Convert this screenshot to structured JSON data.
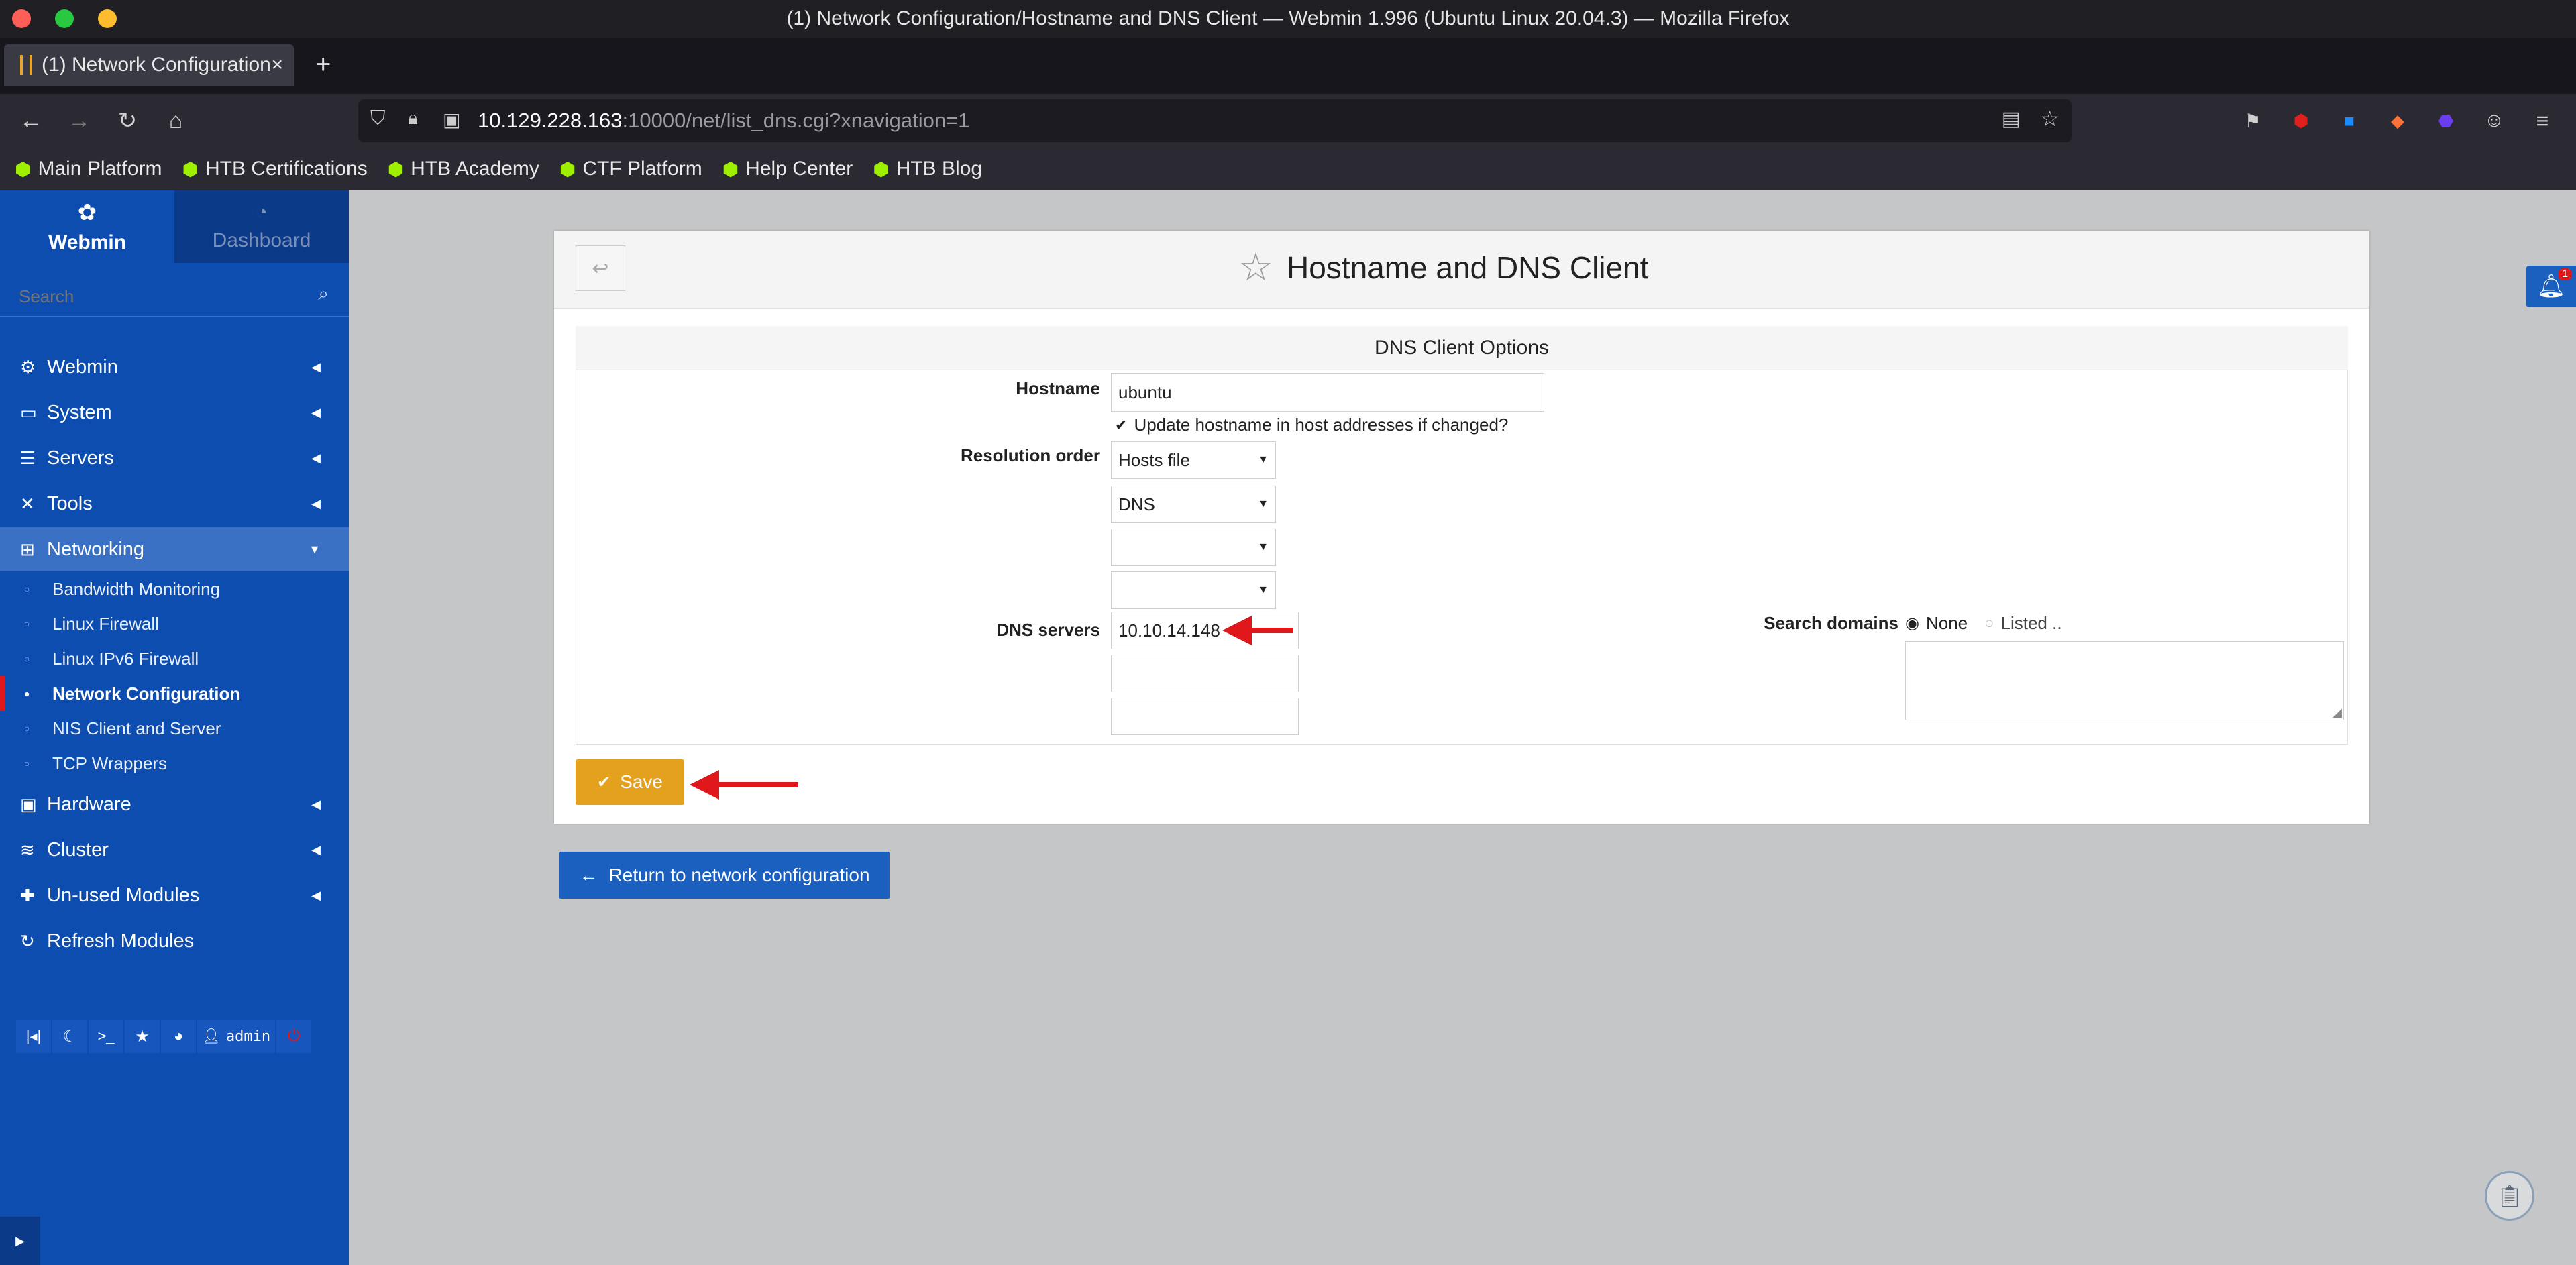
{
  "window": {
    "title": "(1) Network Configuration/Hostname and DNS Client — Webmin 1.996 (Ubuntu Linux 20.04.3) — Mozilla Firefox"
  },
  "browser": {
    "tab_title": "(1) Network Configuration",
    "url_host": "10.129.228.163",
    "url_rest": ":10000/net/list_dns.cgi?xnavigation=1"
  },
  "bookmarks": [
    "Main Platform",
    "HTB Certifications",
    "HTB Academy",
    "CTF Platform",
    "Help Center",
    "HTB Blog"
  ],
  "sidebar": {
    "tab_webmin": "Webmin",
    "tab_dashboard": "Dashboard",
    "search_placeholder": "Search",
    "menu": [
      {
        "label": "Webmin",
        "icon": "gear-icon"
      },
      {
        "label": "System",
        "icon": "laptop-icon"
      },
      {
        "label": "Servers",
        "icon": "server-icon"
      },
      {
        "label": "Tools",
        "icon": "tools-icon"
      },
      {
        "label": "Networking",
        "icon": "network-icon"
      }
    ],
    "submenu": [
      "Bandwidth Monitoring",
      "Linux Firewall",
      "Linux IPv6 Firewall",
      "Network Configuration",
      "NIS Client and Server",
      "TCP Wrappers"
    ],
    "menu_bottom": [
      {
        "label": "Hardware",
        "icon": "hdd-icon"
      },
      {
        "label": "Cluster",
        "icon": "layers-icon"
      },
      {
        "label": "Un-used Modules",
        "icon": "puzzle-icon"
      },
      {
        "label": "Refresh Modules",
        "icon": "refresh-icon"
      }
    ],
    "user": "admin"
  },
  "page": {
    "title": "Hostname and DNS Client",
    "section_title": "DNS Client Options",
    "hostname_label": "Hostname",
    "hostname_value": "ubuntu",
    "update_checkbox_label": "Update hostname in host addresses if changed?",
    "resolution_label": "Resolution order",
    "resolution_options": [
      "Hosts file",
      "DNS",
      "",
      ""
    ],
    "dns_label": "DNS servers",
    "dns_values": [
      "10.10.14.148",
      "",
      ""
    ],
    "search_label": "Search domains",
    "search_none": "None",
    "search_listed": "Listed ..",
    "save_label": "Save",
    "return_label": "Return to network configuration"
  },
  "notification_count": "1"
}
